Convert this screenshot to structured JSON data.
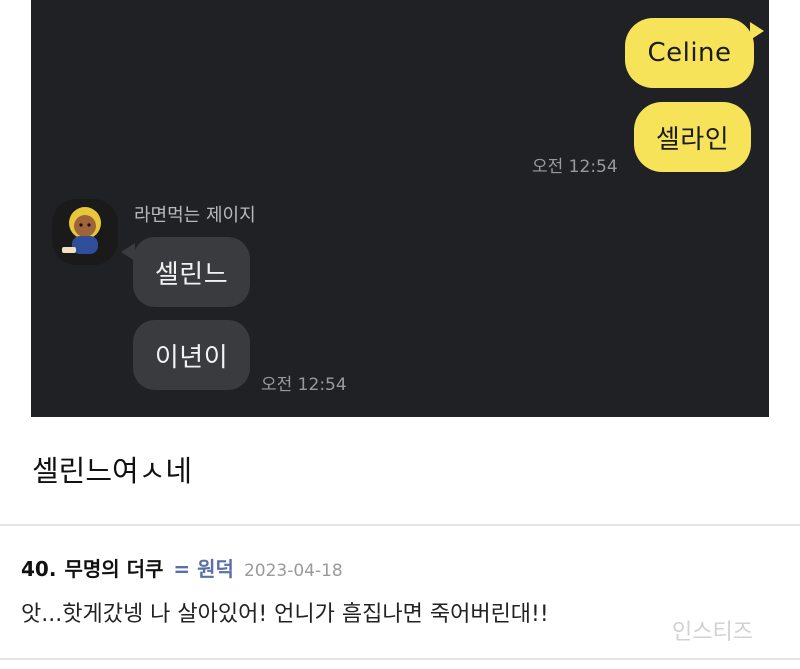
{
  "chat": {
    "messages_out": [
      {
        "text": "Celine"
      },
      {
        "text": "셀라인"
      }
    ],
    "out_time": "오전 12:54",
    "sender_name": "라면먹는 제이지",
    "messages_in": [
      {
        "text": "셀린느"
      },
      {
        "text": "이년이"
      }
    ],
    "in_time": "오전 12:54"
  },
  "caption": "셀린느여ㅅ네",
  "comment": {
    "number": "40.",
    "author": "무명의 더쿠",
    "badge": "= 원덕",
    "date": "2023-04-18",
    "body": "앗...핫게갔넹 나 살아있어! 언니가 흠집나면 죽어버린대!!"
  },
  "watermark": "인스티즈",
  "colors": {
    "chat_bg": "#202124",
    "out_bubble": "#f6e35a",
    "in_bubble": "#3a3b3e",
    "badge": "#5b6fa8"
  }
}
